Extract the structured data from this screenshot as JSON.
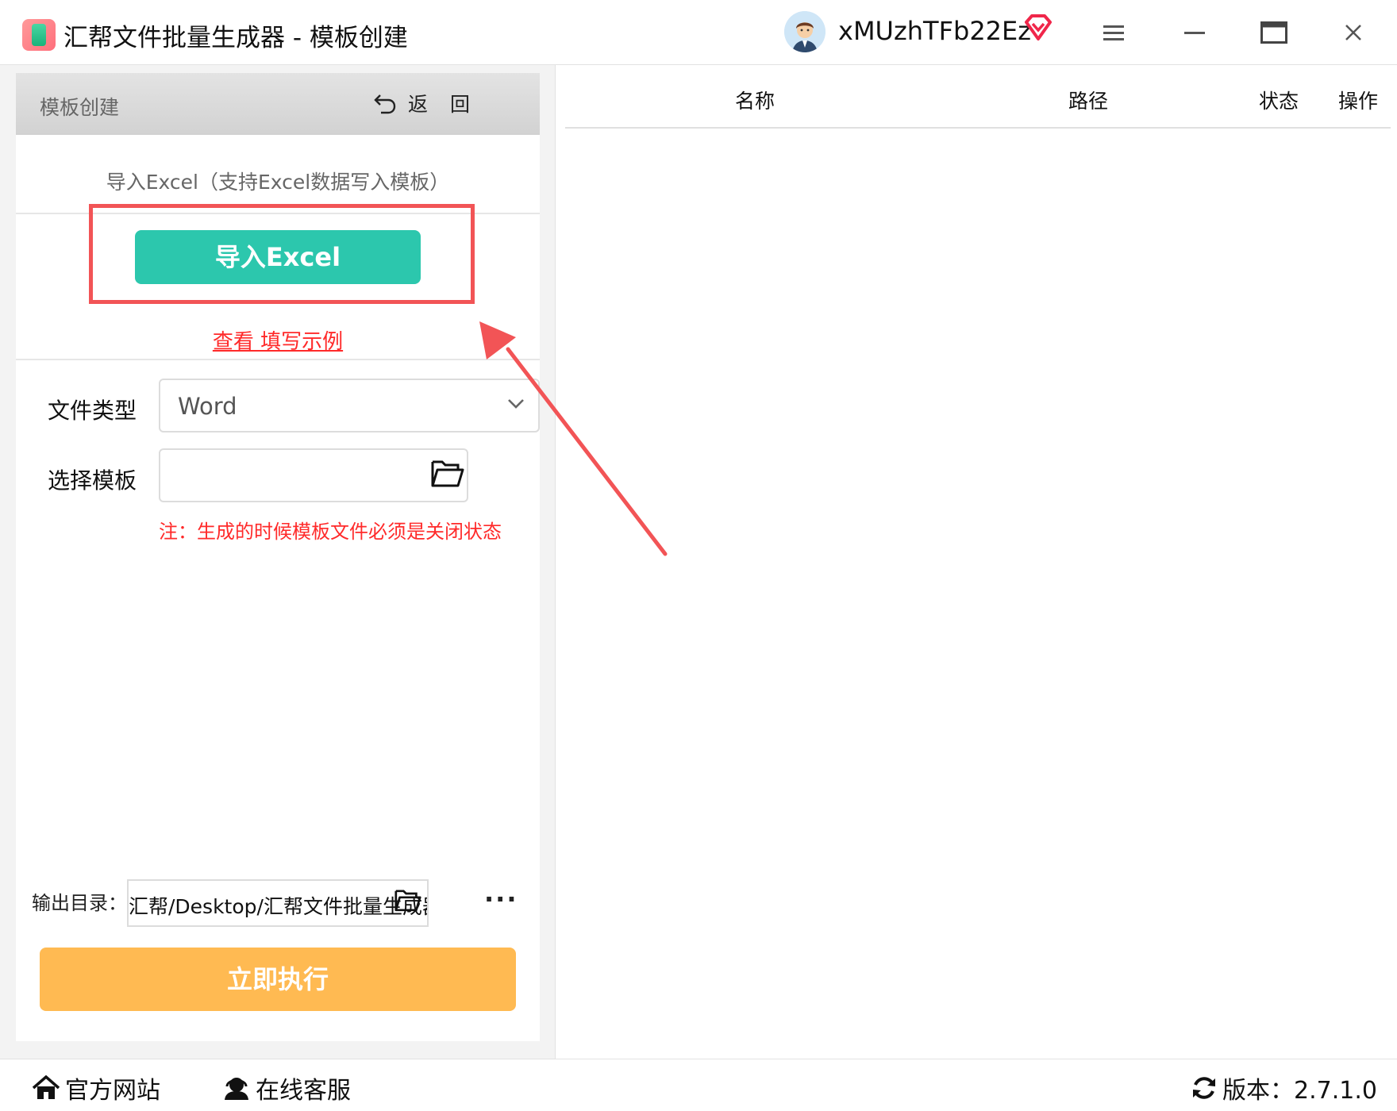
{
  "titlebar": {
    "app_title": "汇帮文件批量生成器 - 模板创建",
    "username": "xMUzhTFb22Ez"
  },
  "left_panel": {
    "header_title": "模板创建",
    "back_label": "返回",
    "import_hint": "导入Excel（支持Excel数据写入模板）",
    "import_button": "导入Excel",
    "example_link": "查看 填写示例",
    "file_type_label": "文件类型",
    "file_type_value": "Word",
    "template_label": "选择模板",
    "template_value": "",
    "note": "注：生成的时候模板文件必须是关闭状态",
    "output_label": "输出目录：",
    "output_value": "汇帮/Desktop/汇帮文件批量生成器",
    "more_label": "···",
    "run_button": "立即执行"
  },
  "table": {
    "columns": [
      "名称",
      "路径",
      "状态",
      "操作"
    ]
  },
  "footer": {
    "website": "官方网站",
    "support": "在线客服",
    "version": "版本：2.7.1.0"
  },
  "colors": {
    "import_button": "#2cc7ad",
    "run_button": "#ffba52",
    "highlight": "#f25456",
    "warning_text": "#ff2a2a"
  }
}
